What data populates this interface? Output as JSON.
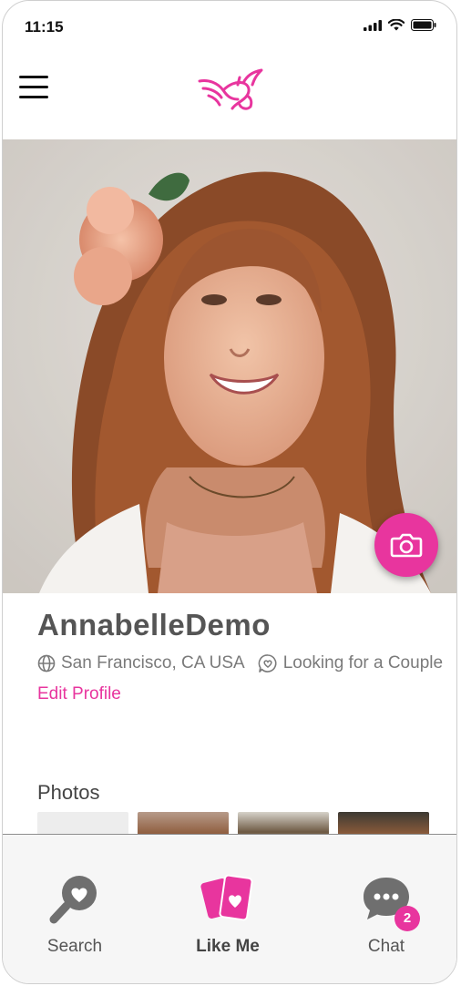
{
  "status_bar": {
    "time": "11:15"
  },
  "brand": {
    "accent": "#e8359e"
  },
  "profile": {
    "name": "AnnabelleDemo",
    "location": "San Francisco, CA USA",
    "looking_for": "Looking for a Couple",
    "edit_label": "Edit Profile"
  },
  "photos": {
    "title": "Photos",
    "thumb_count": 4
  },
  "tabs": [
    {
      "label": "Search",
      "icon": "search-heart-icon",
      "active": false
    },
    {
      "label": "Like Me",
      "icon": "cards-heart-icon",
      "active": true
    },
    {
      "label": "Chat",
      "icon": "chat-bubble-icon",
      "active": false,
      "badge": "2"
    }
  ]
}
